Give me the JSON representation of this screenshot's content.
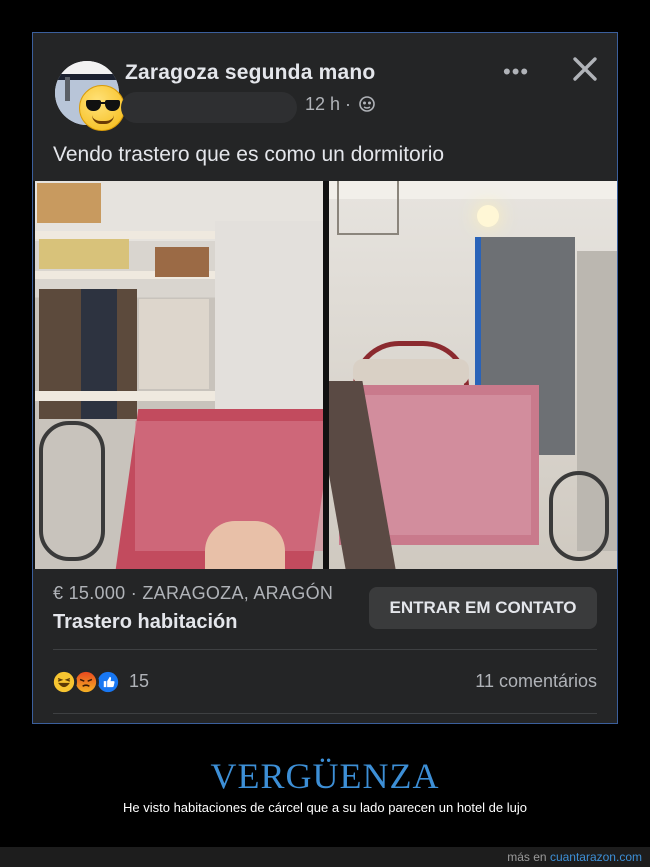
{
  "post": {
    "page_name": "Zaragoza segunda mano",
    "time": "12 h ·",
    "text": "Vendo trastero que es como un dormitorio"
  },
  "listing": {
    "price_location": "€ 15.000 · ZARAGOZA, ARAGÓN",
    "title": "Trastero habitación",
    "contact_button": "ENTRAR EM CONTATO"
  },
  "engagement": {
    "reaction_count": "15",
    "comments": "11 comentários"
  },
  "caption": {
    "headline": "VERGÜENZA",
    "subtitle": "He visto habitaciones de cárcel que a su lado parecen un hotel de lujo"
  },
  "footer": {
    "prefix": "más en",
    "site": "cuantarazon.com"
  },
  "icons": {
    "more": "more-dots-icon",
    "close": "close-icon",
    "audience": "globe-icon",
    "reactions": [
      "haha-icon",
      "angry-icon",
      "like-icon"
    ]
  },
  "colors": {
    "card_bg": "#242526",
    "button_bg": "#3a3b3c",
    "headline_blue": "#3d8fd6",
    "frame_border": "#3b5f9c"
  }
}
